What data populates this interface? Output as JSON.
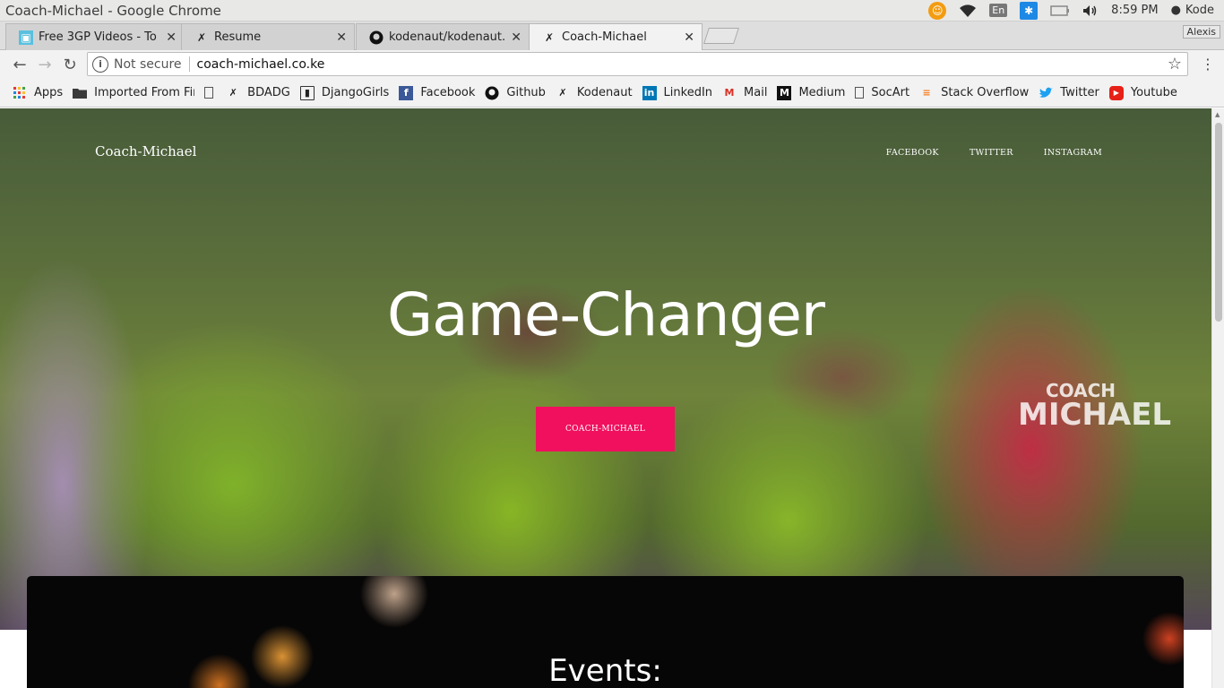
{
  "os": {
    "window_title": "Coach-Michael - Google Chrome",
    "tray": {
      "language": "En",
      "time": "8:59 PM",
      "user": "Kode"
    }
  },
  "browser": {
    "tabs": [
      {
        "label": "Free 3GP Videos - To",
        "icon": "video-site-icon"
      },
      {
        "label": "Resume",
        "icon": "kodenaut-icon"
      },
      {
        "label": "kodenaut/kodenaut.g",
        "icon": "github-icon"
      },
      {
        "label": "Coach-Michael",
        "icon": "kodenaut-icon",
        "active": true
      }
    ],
    "profile_name": "Alexis",
    "omnibox": {
      "security_label": "Not secure",
      "url": "coach-michael.co.ke"
    },
    "bookmarks": [
      {
        "label": "Apps",
        "icon": "apps-grid-icon"
      },
      {
        "label": "Imported From Fir",
        "icon": "folder-icon"
      },
      {
        "label": "BDADG",
        "icon": "kodenaut-icon"
      },
      {
        "label": "DjangoGirls",
        "icon": "book-icon"
      },
      {
        "label": "Facebook",
        "icon": "facebook-icon"
      },
      {
        "label": "Github",
        "icon": "github-icon"
      },
      {
        "label": "Kodenaut",
        "icon": "kodenaut-icon"
      },
      {
        "label": "LinkedIn",
        "icon": "linkedin-icon"
      },
      {
        "label": "Mail",
        "icon": "gmail-icon"
      },
      {
        "label": "Medium",
        "icon": "medium-icon"
      },
      {
        "label": "SocArt",
        "icon": "page-icon"
      },
      {
        "label": "Stack Overflow",
        "icon": "stackoverflow-icon"
      },
      {
        "label": "Twitter",
        "icon": "twitter-icon"
      },
      {
        "label": "Youtube",
        "icon": "youtube-icon"
      }
    ]
  },
  "page": {
    "brand": "Coach-Michael",
    "nav": [
      {
        "label": "FACEBOOK"
      },
      {
        "label": "TWITTER"
      },
      {
        "label": "INSTAGRAM"
      }
    ],
    "headline": "Game-Changer",
    "cta_label": "COACH-MICHAEL",
    "shirt_line1": "COACH",
    "shirt_line2": "MICHAEL",
    "events_title": "Events:",
    "colors": {
      "cta": "#f0105e",
      "panel": "#070606"
    }
  }
}
